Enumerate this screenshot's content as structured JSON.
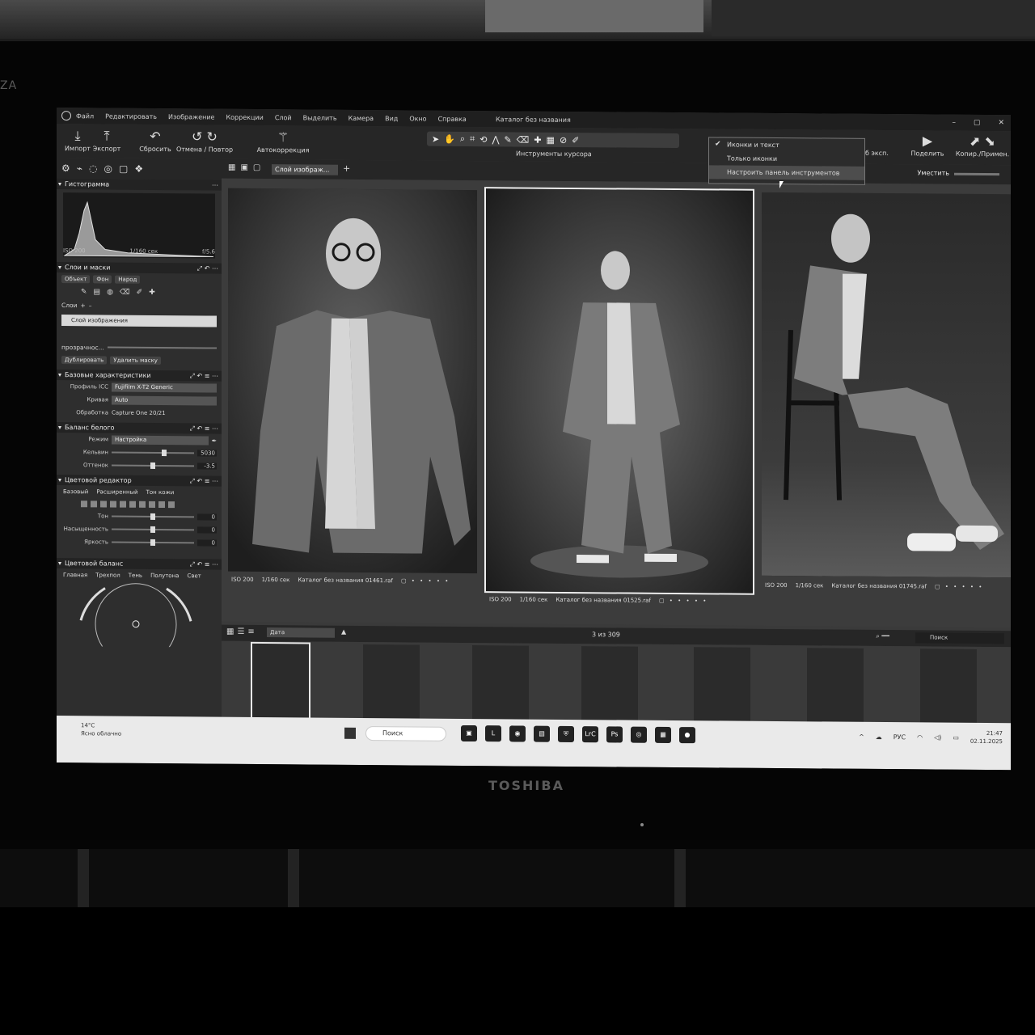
{
  "monitor": {
    "brand": "TOSHIBA",
    "left_logo": "ZA"
  },
  "window": {
    "title": "Каталог без названия"
  },
  "menu": [
    "Файл",
    "Редактировать",
    "Изображение",
    "Коррекции",
    "Слой",
    "Выделить",
    "Камера",
    "Вид",
    "Окно",
    "Справка"
  ],
  "toolbar": {
    "import_label": "Импорт",
    "export_label": "Экспорт",
    "reset_label": "Сбросить",
    "undo_label": "Отмена / Повтор",
    "autocorrect_label": "Автокоррекция",
    "cursor_tools_label": "Инструменты курсора",
    "exposure_label": "об эксп.",
    "share_label": "Поделить",
    "copy_apply_label": "Копир./Примен."
  },
  "toolbar_menu": {
    "options": [
      "Иконки и текст",
      "Только иконки",
      "Настроить панель инструментов"
    ],
    "checked_index": 0,
    "highlighted_index": 2
  },
  "viewer_bar": {
    "layer_select": "Слой изображ...",
    "fit_label": "Уместить"
  },
  "histogram": {
    "title": "Гистограмма",
    "iso": "ISO 200",
    "shutter": "1/160 сек",
    "aperture": "f/5.6"
  },
  "layers": {
    "title": "Слои и маски",
    "object_button": "Объект",
    "background_button": "Фон",
    "people_button": "Народ",
    "layers_label": "Слои",
    "selected_layer": "Слой изображения",
    "opacity_label": "прозрачнос...",
    "button_left": "Дублировать",
    "button_right": "Удалить маску"
  },
  "base_characteristics": {
    "title": "Базовые характеристики",
    "icc_label": "Профиль ICC",
    "icc_value": "Fujifilm X-T2 Generic",
    "curve_label": "Кривая",
    "curve_value": "Auto",
    "processing_label": "Обработка",
    "processing_value": "Capture One 20/21"
  },
  "white_balance": {
    "title": "Баланс белого",
    "mode_label": "Режим",
    "mode_value": "Настройка",
    "kelvin_label": "Кельвин",
    "kelvin_value": "5030",
    "tint_label": "Оттенок",
    "tint_value": "-3.5",
    "kelvin_position": 0.64,
    "tint_position": 0.5
  },
  "color_editor": {
    "title": "Цветовой редактор",
    "tabs": [
      "Базовый",
      "Расширенный",
      "Тон кожи"
    ],
    "sliders": [
      {
        "label": "Тон",
        "value": "0",
        "position": 0.5
      },
      {
        "label": "Насыщенность",
        "value": "0",
        "position": 0.5
      },
      {
        "label": "Яркость",
        "value": "0",
        "position": 0.5
      }
    ]
  },
  "color_balance": {
    "title": "Цветовой баланс",
    "tabs": [
      "Главная",
      "Трехпол",
      "Тень",
      "Полутона",
      "Свет"
    ]
  },
  "photos": [
    {
      "iso": "ISO 200",
      "shutter": "1/160 сек",
      "name": "Каталог без названия 01461.raf"
    },
    {
      "iso": "ISO 200",
      "shutter": "1/160 сек",
      "name": "Каталог без названия 01525.raf"
    },
    {
      "iso": "ISO 200",
      "shutter": "1/160 сек",
      "name": "Каталог без названия 01745.raf"
    }
  ],
  "filmstrip": {
    "sort": "Дата",
    "count_label": "3 из 309",
    "search_placeholder": "Поиск"
  },
  "taskbar": {
    "temperature": "14°C",
    "weather": "Ясно облачно",
    "search_placeholder": "Поиск",
    "lang": "РУС",
    "time": "21:47",
    "date": "02.11.2025"
  }
}
